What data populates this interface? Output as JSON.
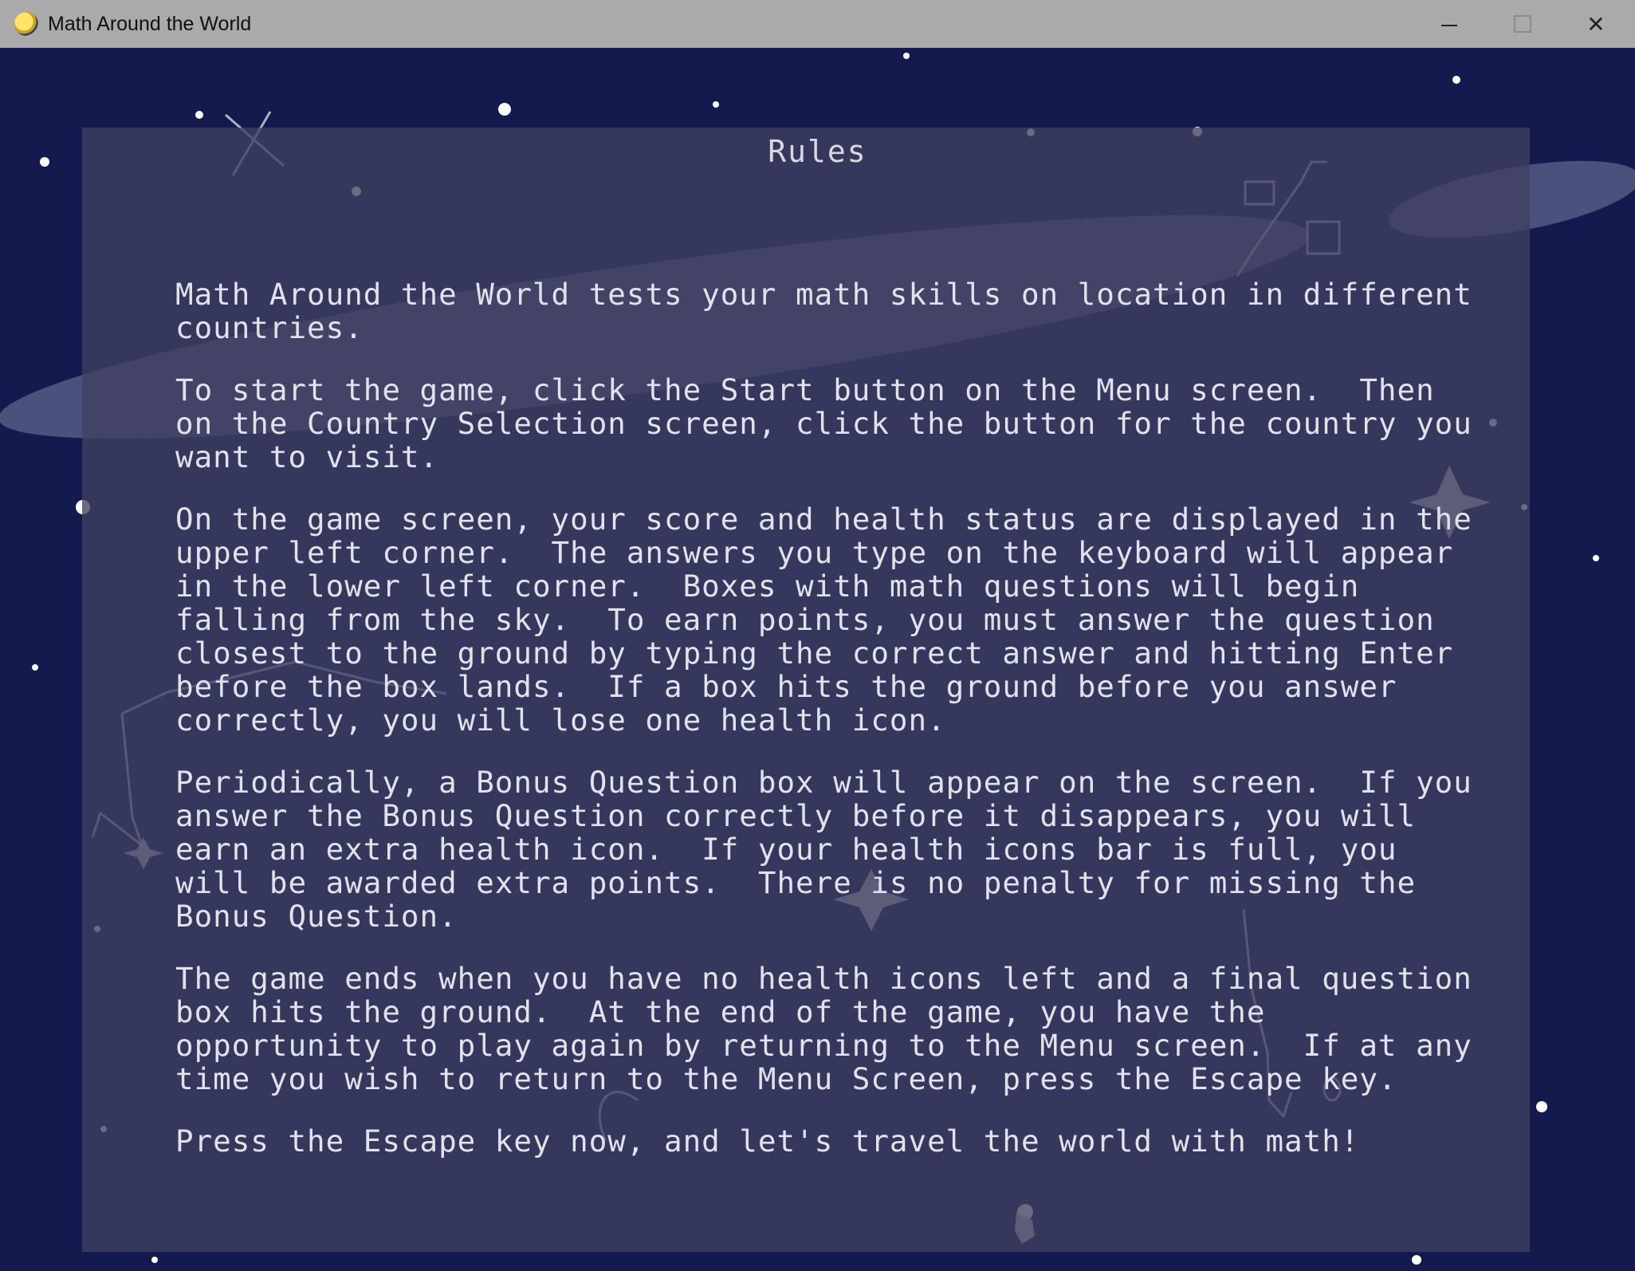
{
  "window": {
    "title": "Math Around the World",
    "controls": {
      "minimize": "minimize",
      "maximize": "maximize",
      "close": "✕"
    }
  },
  "rules": {
    "heading": "Rules",
    "paragraphs": [
      "Math Around the World tests your math skills on location in different countries.",
      "To start the game, click the Start button on the Menu screen.  Then on the Country Selection screen, click the button for the country you want to visit.",
      "On the game screen, your score and health status are displayed in the upper left corner.  The answers you type on the keyboard will appear in the lower left corner.  Boxes with math questions will begin falling from the sky.  To earn points, you must answer the question closest to the ground by typing the correct answer and hitting Enter before the box lands.  If a box hits the ground before you answer correctly, you will lose one health icon.",
      "Periodically, a Bonus Question box will appear on the screen.  If you answer the Bonus Question correctly before it disappears, you will earn an extra health icon.  If your health icons bar is full, you will be awarded extra points.  There is no penalty for missing the Bonus Question.",
      "The game ends when you have no health icons left and a final question box hits the ground.  At the end of the game, you have the opportunity to play again by returning to the Menu screen.  If at any time you wish to return to the Menu Screen, press the Escape key.",
      "Press the Escape key now, and let's travel the world with math!"
    ]
  },
  "colors": {
    "background": "#141a4e",
    "panel": "#404060",
    "text": "#e2e2ec",
    "titlebar": "#aaaaaa"
  },
  "icons": [
    "app-icon",
    "minimize-icon",
    "maximize-icon",
    "close-icon"
  ]
}
